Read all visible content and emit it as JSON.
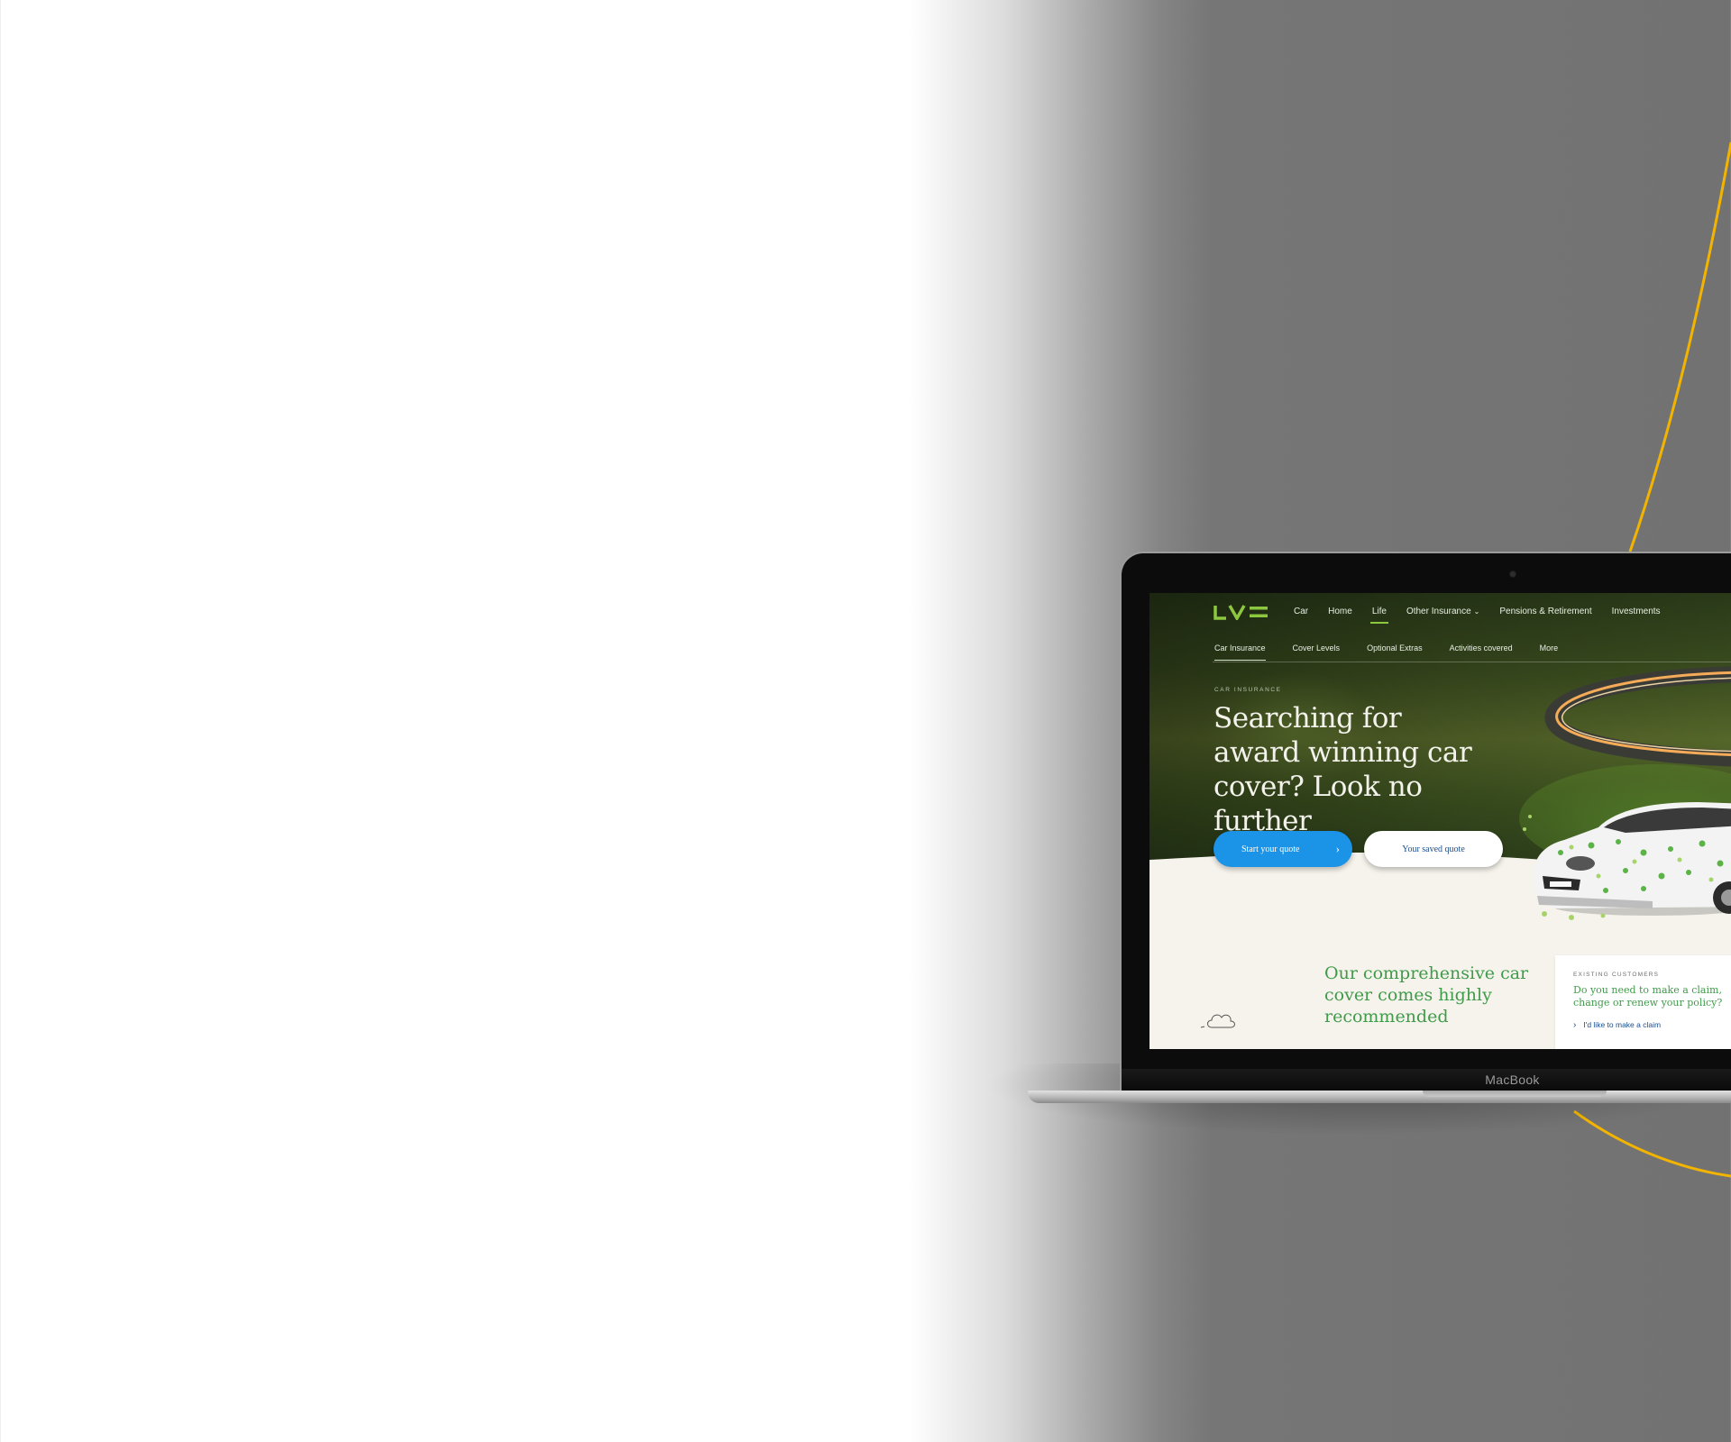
{
  "device": {
    "brand_label": "MacBook"
  },
  "website": {
    "logo_text": "LV=",
    "nav": {
      "items": [
        {
          "label": "Car",
          "active": false
        },
        {
          "label": "Home",
          "active": false
        },
        {
          "label": "Life",
          "active": true
        },
        {
          "label": "Other Insurance",
          "active": false
        },
        {
          "label": "Pensions & Retirement",
          "active": false
        },
        {
          "label": "Investments",
          "active": false
        }
      ]
    },
    "subnav": {
      "items": [
        {
          "label": "Car Insurance",
          "active": true
        },
        {
          "label": "Cover Levels",
          "active": false
        },
        {
          "label": "Optional Extras",
          "active": false
        },
        {
          "label": "Activities covered",
          "active": false
        },
        {
          "label": "More",
          "active": false
        }
      ]
    },
    "hero": {
      "eyebrow": "CAR INSURANCE",
      "headline": "Searching for award winning car cover? Look no further",
      "primary_button": "Start your quote",
      "secondary_button": "Your saved quote"
    },
    "section": {
      "heading": "Our comprehensive car cover comes highly recommended"
    },
    "existing_card": {
      "eyebrow": "EXISTING CUSTOMERS",
      "title": "Do you need to make a claim, change or renew your policy?",
      "link": "I'd like to make a claim"
    }
  },
  "colors": {
    "accent_green": "#8dc63f",
    "heading_green": "#3f9b4a",
    "button_blue": "#1b93e6",
    "link_navy": "#1a4e8f",
    "decorative_arc": "#f2b400"
  },
  "icons": [
    "chevron-down-icon",
    "chevron-right-icon",
    "cloud-icon",
    "camera-dot"
  ]
}
